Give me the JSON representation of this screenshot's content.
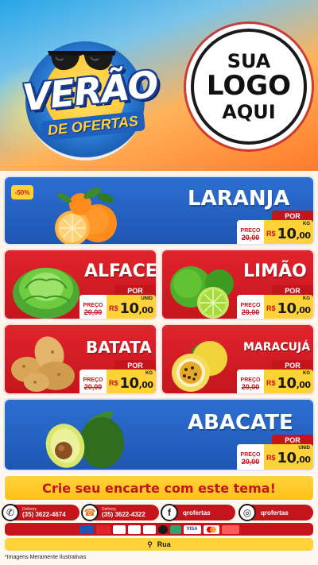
{
  "header": {
    "title_main": "VERÃO",
    "title_sub": "DE OFERTAS",
    "logo_placeholder": [
      "SUA",
      "LOGO",
      "AQUI"
    ]
  },
  "products": [
    {
      "name": "LARANJA",
      "discount": "-50%",
      "price_label": "PREÇO",
      "old_price": "20,00",
      "currency": "R$",
      "price_int": "10",
      "price_dec": ",00",
      "por_label": "POR",
      "unit": "KG"
    },
    {
      "name": "ALFACE",
      "price_label": "PREÇO",
      "old_price": "20,00",
      "currency": "R$",
      "price_int": "10",
      "price_dec": ",00",
      "por_label": "POR",
      "unit": "UNID"
    },
    {
      "name": "LIMÃO",
      "price_label": "PREÇO",
      "old_price": "20,00",
      "currency": "R$",
      "price_int": "10",
      "price_dec": ",00",
      "por_label": "POR",
      "unit": "KG"
    },
    {
      "name": "BATATA",
      "price_label": "PREÇO",
      "old_price": "20,00",
      "currency": "R$",
      "price_int": "10",
      "price_dec": ",00",
      "por_label": "POR",
      "unit": "KG"
    },
    {
      "name": "MARACUJÁ",
      "price_label": "PREÇO",
      "old_price": "20,00",
      "currency": "R$",
      "price_int": "10",
      "price_dec": ",00",
      "por_label": "POR",
      "unit": "KG"
    },
    {
      "name": "ABACATE",
      "price_label": "PREÇO",
      "old_price": "20,00",
      "currency": "R$",
      "price_int": "10",
      "price_dec": ",00",
      "por_label": "POR",
      "unit": "UNID"
    }
  ],
  "banner": "Crie seu encarte com este tema!",
  "contacts": [
    {
      "label": "Delivery",
      "value": "(35) 3622-4674",
      "icon": "whatsapp-icon"
    },
    {
      "label": "Delivery",
      "value": "(35) 3622-4322",
      "icon": "phone-icon"
    },
    {
      "value": "qrofertas",
      "icon": "facebook-icon"
    },
    {
      "value": "qrofertas",
      "icon": "instagram-icon"
    }
  ],
  "payments": [
    "VISA",
    "Master",
    "Elo",
    "Hiper",
    "Amex",
    "Pix"
  ],
  "address": "Rua",
  "disclaimer": "*Imagens Meramente Ilustrativas",
  "colors": {
    "red": "#c4151d",
    "blue": "#1f56b3",
    "yellow": "#ffd23a",
    "orange": "#ff9a3c"
  }
}
